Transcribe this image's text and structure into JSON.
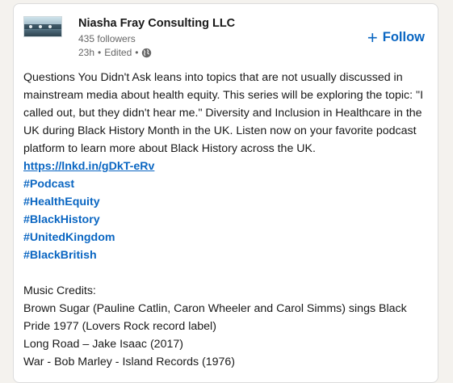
{
  "post": {
    "author_name": "Niasha Fray Consulting LLC",
    "followers": "435 followers",
    "time": "23h",
    "separator": "•",
    "edited": "Edited",
    "separator2": "•",
    "visibility_icon": "globe-icon",
    "follow_icon": "plus-icon",
    "follow_label": "Follow",
    "body_text": "Questions You Didn't Ask leans into topics that are not usually discussed in mainstream media about health equity. This series will be exploring the topic: \"I called out, but they didn't hear me.\" Diversity and Inclusion in Healthcare in the UK during Black History Month in the UK. Listen now on your favorite podcast platform to learn more about Black History across the UK.",
    "link_text": "https://lnkd.in/gDkT-eRv",
    "hashtags": [
      "#Podcast",
      "#HealthEquity",
      "#BlackHistory",
      "#UnitedKingdom",
      "#BlackBritish"
    ],
    "credits_heading": "Music Credits:",
    "credits": [
      "Brown Sugar (Pauline Catlin, Caron Wheeler and Carol Simms) sings Black Pride 1977 (Lovers Rock record label)",
      "Long Road – Jake Isaac (2017)",
      "War - Bob Marley - Island Records (1976)"
    ]
  },
  "colors": {
    "brand_blue": "#0a66c2",
    "text": "#191919",
    "muted": "#666666",
    "page_bg": "#f4f2ee"
  }
}
